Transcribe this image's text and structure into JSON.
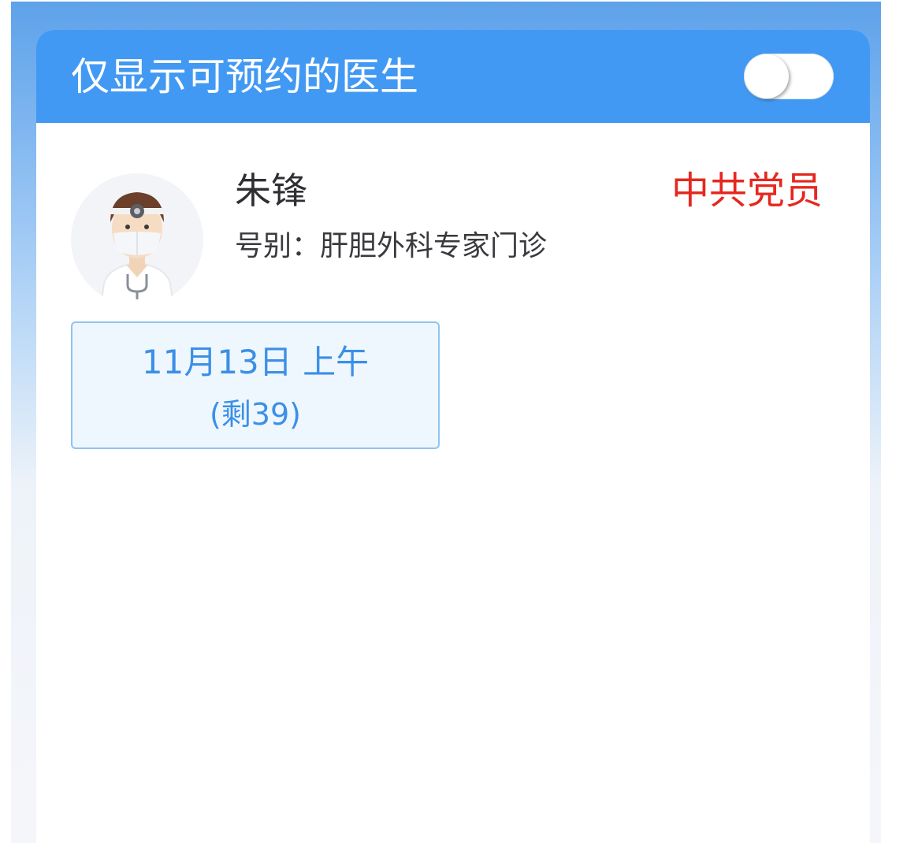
{
  "header": {
    "title": "仅显示可预约的医生",
    "toggle_on": false
  },
  "doctor": {
    "avatar_icon": "doctor-avatar-icon",
    "name": "朱锋",
    "badge": "中共党员",
    "clinic_label": "号别：",
    "clinic": "肝胆外科专家门诊"
  },
  "slots": [
    {
      "date": "11月13日 上午",
      "remaining": "(剩39)"
    }
  ],
  "colors": {
    "header_bg": "#4299f3",
    "badge": "#e5281f",
    "slot_text": "#3b8fe8",
    "slot_bg": "#eef7fd",
    "slot_border": "#8fc4f4"
  }
}
